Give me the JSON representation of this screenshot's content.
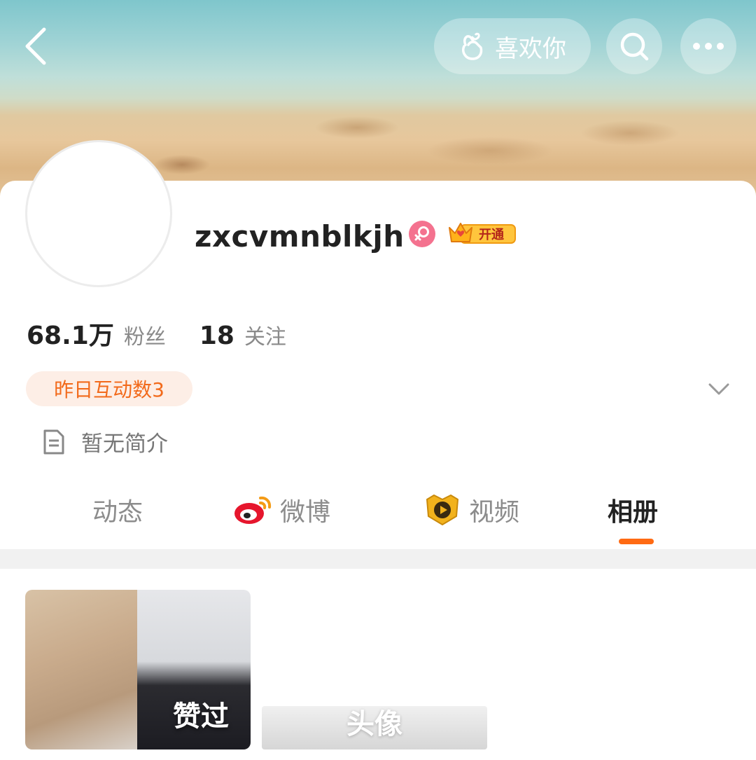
{
  "header": {
    "back_icon": "chevron-left-icon",
    "like_label": "喜欢你",
    "like_icon": "finger-heart-icon",
    "search_icon": "search-icon",
    "more_icon": "more-dots-icon"
  },
  "profile": {
    "username": "zxcvmnblkjh",
    "gender": "female",
    "vip_label": "开通",
    "followers_count": "68.1万",
    "followers_label": "粉丝",
    "following_count": "18",
    "following_label": "关注",
    "interaction_tag": "昨日互动数3",
    "bio": "暂无简介"
  },
  "tabs": [
    {
      "label": "动态",
      "icon": null,
      "active": false
    },
    {
      "label": "微博",
      "icon": "weibo-logo-icon",
      "active": false
    },
    {
      "label": "视频",
      "icon": "video-play-icon",
      "active": false
    },
    {
      "label": "相册",
      "icon": null,
      "active": true
    }
  ],
  "album": [
    {
      "label": "赞过"
    },
    {
      "label": "头像"
    }
  ],
  "colors": {
    "accent": "#ff6a13",
    "interaction_text": "#f26a1b",
    "interaction_bg": "#fdeee6",
    "gender_badge": "#f4728f"
  }
}
